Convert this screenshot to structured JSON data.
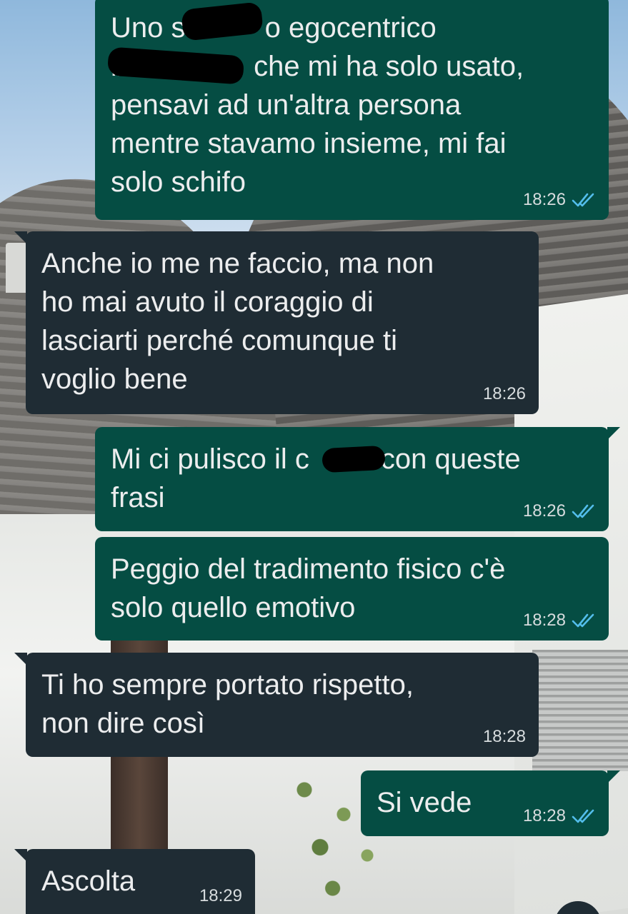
{
  "colors": {
    "outgoing_bubble": "#054d43",
    "incoming_bubble": "#1f2c34",
    "read_ticks": "#53bdeb",
    "message_text": "#ecedee",
    "timestamp_text": "#d7dcde"
  },
  "messages": [
    {
      "direction": "outgoing",
      "text": "Uno st         o egocentrico\nba              che mi ha solo usato,\npensavi ad un'altra persona\nmentre stavamo insieme, mi fai\nsolo schifo",
      "time": "18:26",
      "status": "read",
      "status_icon": "double-check-icon"
    },
    {
      "direction": "incoming",
      "text": "Anche io me ne faccio, ma non\nho mai avuto il coraggio di\nlasciarti perché comunque ti\nvoglio bene",
      "time": "18:26"
    },
    {
      "direction": "outgoing",
      "text": "Mi ci pulisco il c      o con queste\nfrasi",
      "time": "18:26",
      "status": "read",
      "status_icon": "double-check-icon"
    },
    {
      "direction": "outgoing",
      "text": "Peggio del tradimento fisico c'è\nsolo quello emotivo",
      "time": "18:28",
      "status": "read",
      "status_icon": "double-check-icon"
    },
    {
      "direction": "incoming",
      "text": "Ti ho sempre portato rispetto,\nnon dire così",
      "time": "18:28"
    },
    {
      "direction": "outgoing",
      "text": "Si vede",
      "time": "18:28",
      "status": "read",
      "status_icon": "double-check-icon"
    },
    {
      "direction": "incoming",
      "text": "Ascolta",
      "time": "18:29"
    }
  ]
}
